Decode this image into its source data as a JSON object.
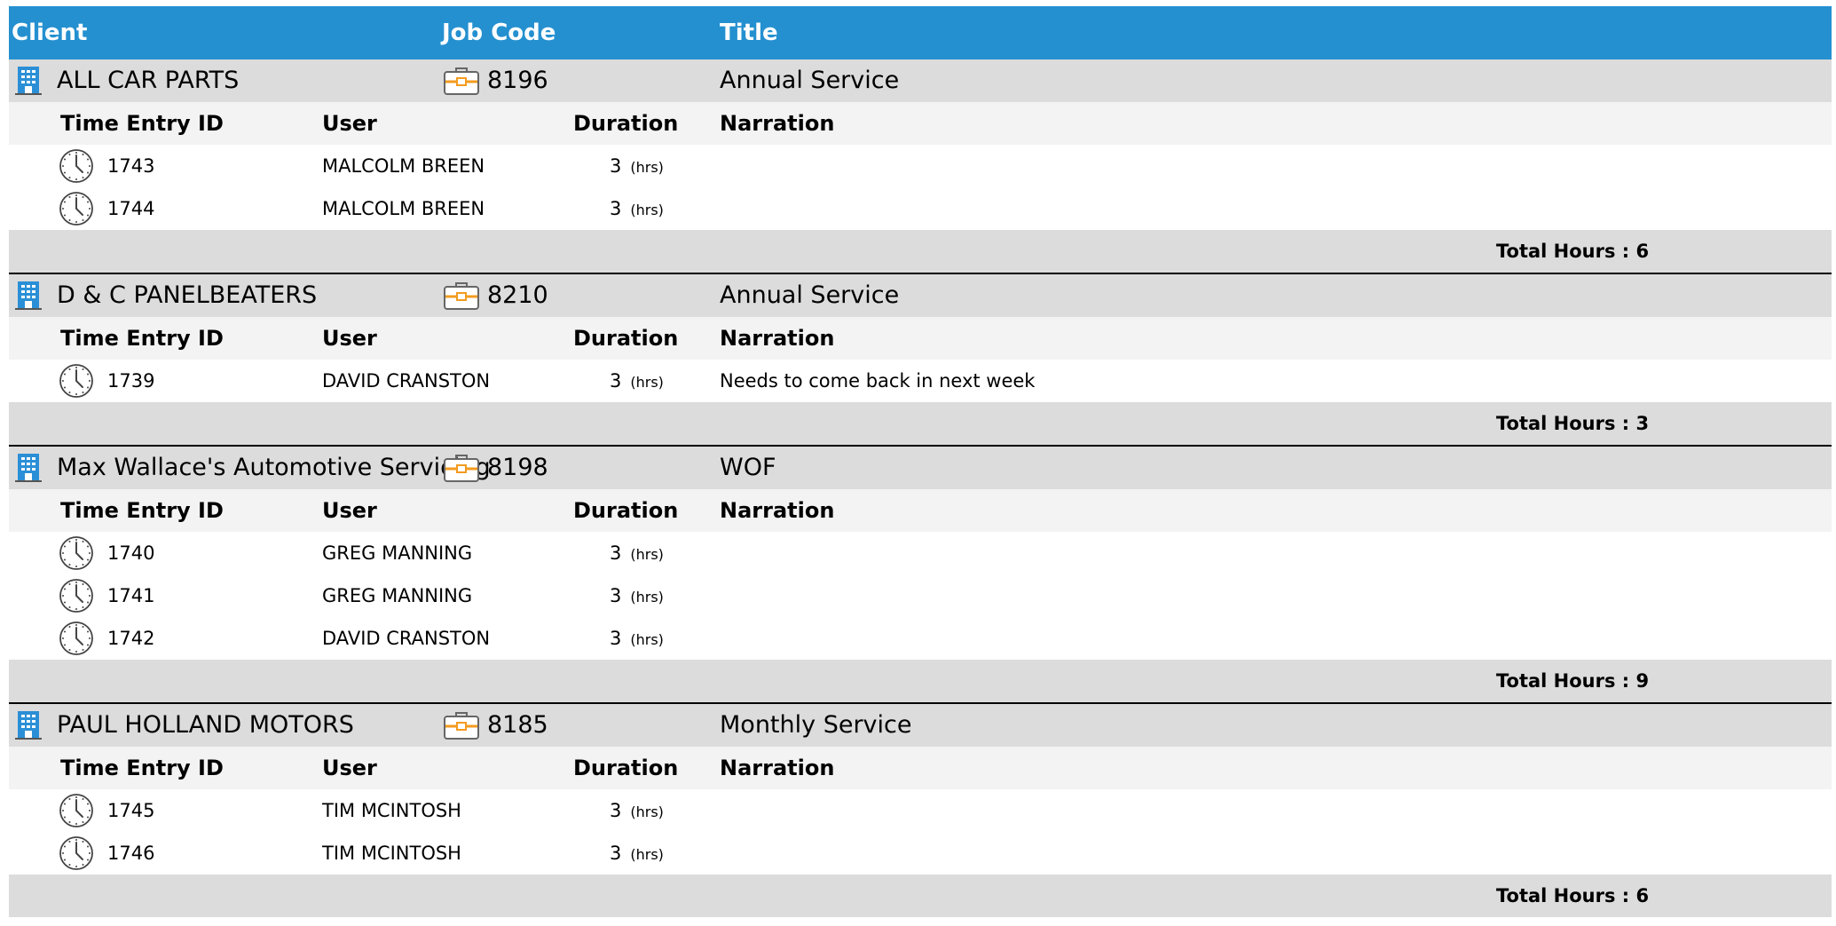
{
  "header": {
    "client": "Client",
    "job_code": "Job Code",
    "title": "Title"
  },
  "sub_header": {
    "time_entry_id": "Time Entry ID",
    "user": "User",
    "duration": "Duration",
    "narration": "Narration"
  },
  "duration_unit": "(hrs)",
  "total_prefix": "Total Hours : ",
  "icons": {
    "client": "building-icon",
    "job": "briefcase-icon",
    "entry": "clock-icon"
  },
  "colors": {
    "header_bg": "#2490d0",
    "group_bg": "#dcdcdc",
    "sub_header_bg": "#f3f3f3",
    "building_blue": "#2a8fd6",
    "briefcase_orange": "#f39b1f"
  },
  "groups": [
    {
      "client": "ALL CAR PARTS",
      "job_code": "8196",
      "title": "Annual Service",
      "entries": [
        {
          "id": "1743",
          "user": "MALCOLM BREEN",
          "duration": "3",
          "narration": ""
        },
        {
          "id": "1744",
          "user": "MALCOLM BREEN",
          "duration": "3",
          "narration": ""
        }
      ],
      "total": "6"
    },
    {
      "client": "D & C PANELBEATERS",
      "job_code": "8210",
      "title": "Annual Service",
      "entries": [
        {
          "id": "1739",
          "user": "DAVID CRANSTON",
          "duration": "3",
          "narration": "Needs to come back in next week"
        }
      ],
      "total": "3"
    },
    {
      "client": "Max Wallace's Automotive Servicing",
      "job_code": "8198",
      "title": "WOF",
      "entries": [
        {
          "id": "1740",
          "user": "GREG MANNING",
          "duration": "3",
          "narration": ""
        },
        {
          "id": "1741",
          "user": "GREG MANNING",
          "duration": "3",
          "narration": ""
        },
        {
          "id": "1742",
          "user": "DAVID CRANSTON",
          "duration": "3",
          "narration": ""
        }
      ],
      "total": "9"
    },
    {
      "client": "PAUL HOLLAND MOTORS",
      "job_code": "8185",
      "title": "Monthly Service",
      "entries": [
        {
          "id": "1745",
          "user": "TIM MCINTOSH",
          "duration": "3",
          "narration": ""
        },
        {
          "id": "1746",
          "user": "TIM MCINTOSH",
          "duration": "3",
          "narration": ""
        }
      ],
      "total": "6"
    }
  ]
}
